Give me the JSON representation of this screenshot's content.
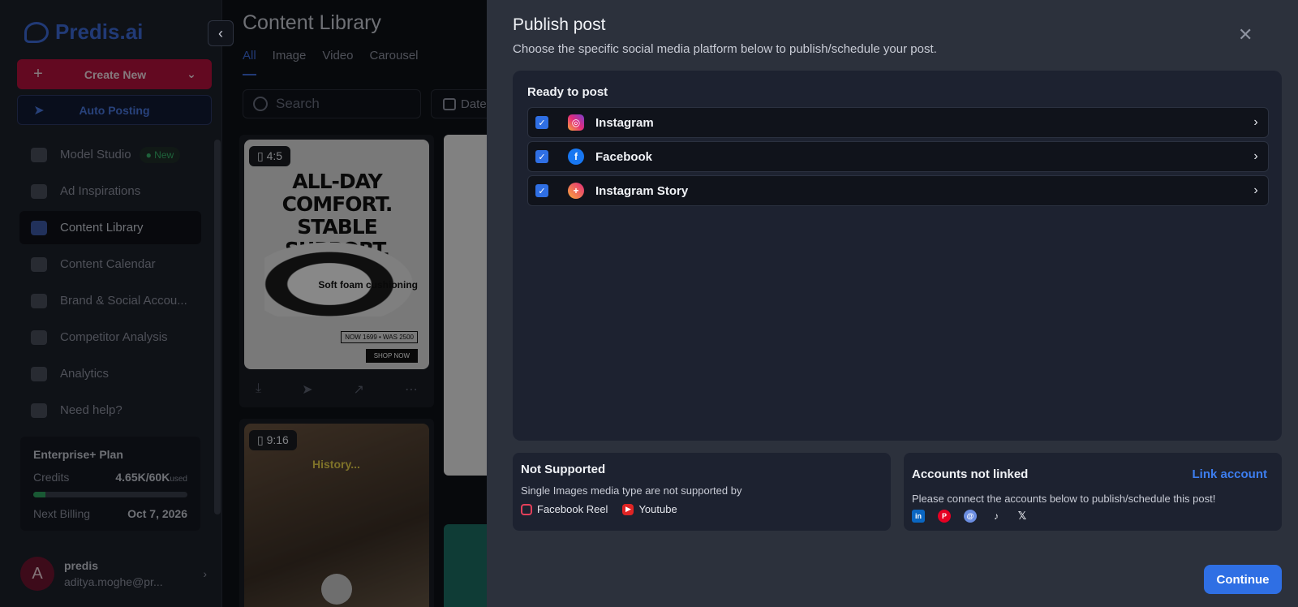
{
  "sidebar": {
    "logo": "Predis.ai",
    "create_new": "Create New",
    "auto_posting": "Auto Posting",
    "items": [
      {
        "label": "Model Studio",
        "badge": "New"
      },
      {
        "label": "Ad Inspirations"
      },
      {
        "label": "Content Library"
      },
      {
        "label": "Content Calendar"
      },
      {
        "label": "Brand & Social Accou..."
      },
      {
        "label": "Competitor Analysis"
      },
      {
        "label": "Analytics"
      },
      {
        "label": "Need help?"
      }
    ],
    "plan": {
      "title": "Enterprise+ Plan",
      "credits_label": "Credits",
      "credits_value": "4.65K/60K",
      "credits_suffix": "used",
      "credits_fraction": 0.0775,
      "billing_label": "Next Billing",
      "billing_value": "Oct 7, 2026"
    },
    "user": {
      "initial": "A",
      "name": "predis",
      "email": "aditya.moghe@pr..."
    }
  },
  "library": {
    "title": "Content Library",
    "tabs": [
      "All",
      "Image",
      "Video",
      "Carousel"
    ],
    "search_placeholder": "Search",
    "date_label": "Date",
    "card1": {
      "ratio": "4:5",
      "headline": "ALL-DAY COMFORT. STABLE SUPPORT.",
      "tagline": "Soft foam cushioning",
      "price": "NOW 1699 • WAS 2500",
      "cta": "SHOP NOW"
    },
    "card2": {
      "ratio": "9:16",
      "caption": "History..."
    }
  },
  "modal": {
    "title": "Publish post",
    "subtitle": "Choose the specific social media platform below to publish/schedule your post.",
    "ready_title": "Ready to post",
    "platforms": [
      {
        "name": "Instagram",
        "icon": "instagram-icon"
      },
      {
        "name": "Facebook",
        "icon": "facebook-icon"
      },
      {
        "name": "Instagram Story",
        "icon": "instagram-story-icon"
      }
    ],
    "not_supported": {
      "title": "Not Supported",
      "desc": "Single Images media type are not supported by",
      "items": [
        "Facebook Reel",
        "Youtube"
      ]
    },
    "accounts": {
      "title": "Accounts not linked",
      "link_label": "Link account",
      "desc": "Please connect the accounts below to publish/schedule this post!",
      "icons": [
        "linkedin-icon",
        "pinterest-icon",
        "threads-icon",
        "tiktok-icon",
        "x-icon"
      ]
    },
    "continue_label": "Continue"
  }
}
